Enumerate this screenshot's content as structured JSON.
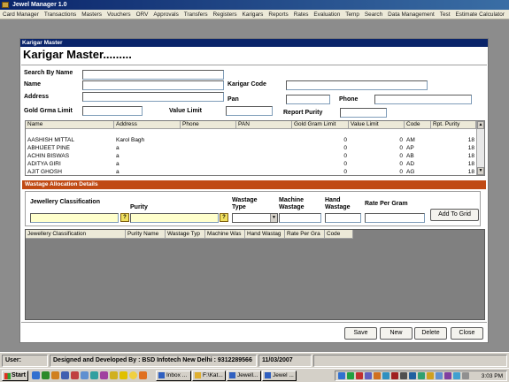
{
  "app": {
    "title": "Jewel Manager 1.0"
  },
  "menu": [
    "Card Manager",
    "Transactions",
    "Masters",
    "Vouchers",
    "ORV",
    "Approvals",
    "Transfers",
    "Registers",
    "Karigars",
    "Reports",
    "Rates",
    "Evaluation",
    "Temp",
    "Search",
    "Data Management",
    "Test",
    "Estimate Calculator"
  ],
  "form": {
    "caption": "Karigar Master",
    "heading": "Karigar Master.........",
    "labels": {
      "search_by_name": "Search By Name",
      "name": "Name",
      "karigar_code": "Karigar Code",
      "address": "Address",
      "pan": "Pan",
      "phone": "Phone",
      "gold_grma_limit": "Gold Grma Limit",
      "value_limit": "Value Limit",
      "report_purity": "Report Purity"
    }
  },
  "grid": {
    "columns": [
      "Name",
      "Address",
      "Phone",
      "PAN",
      "Gold Gram Limit",
      "Value Limit",
      "Code",
      "Rpt. Purity"
    ],
    "rows": [
      [
        "AASHISH MITTAL",
        "Karol Bagh",
        "",
        "",
        "0",
        "0",
        "AM",
        "18"
      ],
      [
        "ABHIJEET PINE",
        "a",
        "",
        "",
        "0",
        "0",
        "AP",
        "18"
      ],
      [
        "ACHIN BISWAS",
        "a",
        "",
        "",
        "0",
        "0",
        "AB",
        "18"
      ],
      [
        "ADITYA GIRI",
        "a",
        "",
        "",
        "0",
        "0",
        "AD",
        "18"
      ],
      [
        "AJIT GHOSH",
        "a",
        "",
        "",
        "0",
        "0",
        "AG",
        "18"
      ]
    ]
  },
  "wastage": {
    "band_title": "Wastage Allocation Details",
    "labels": {
      "jewellery_classification": "Jewellery Classification",
      "purity": "Purity",
      "wastage_type": "Wastage Type",
      "machine_wastage": "Machine Wastage",
      "hand_wastage": "Hand Wastage",
      "rate_per_gram": "Rate Per Gram"
    },
    "add_to_grid": "Add To Grid",
    "grid_columns": [
      "Jewellery Classification",
      "Purity Name",
      "Wastage Typ",
      "Machine Was",
      "Hand Wastag",
      "Rate Per Gra",
      "Code"
    ]
  },
  "buttons": {
    "save": "Save",
    "new": "New",
    "delete": "Delete",
    "close": "Close"
  },
  "status": {
    "user": "User:",
    "developer": "Designed and Developed By : BSD Infotech New Delhi : 9312289566",
    "date": "11/03/2007"
  },
  "taskbar": {
    "start": "Start",
    "tasks": [
      "Inbox ...",
      "F:\\Kat...",
      "Jewell...",
      "Jewel ..."
    ],
    "clock": "3:03 PM"
  }
}
